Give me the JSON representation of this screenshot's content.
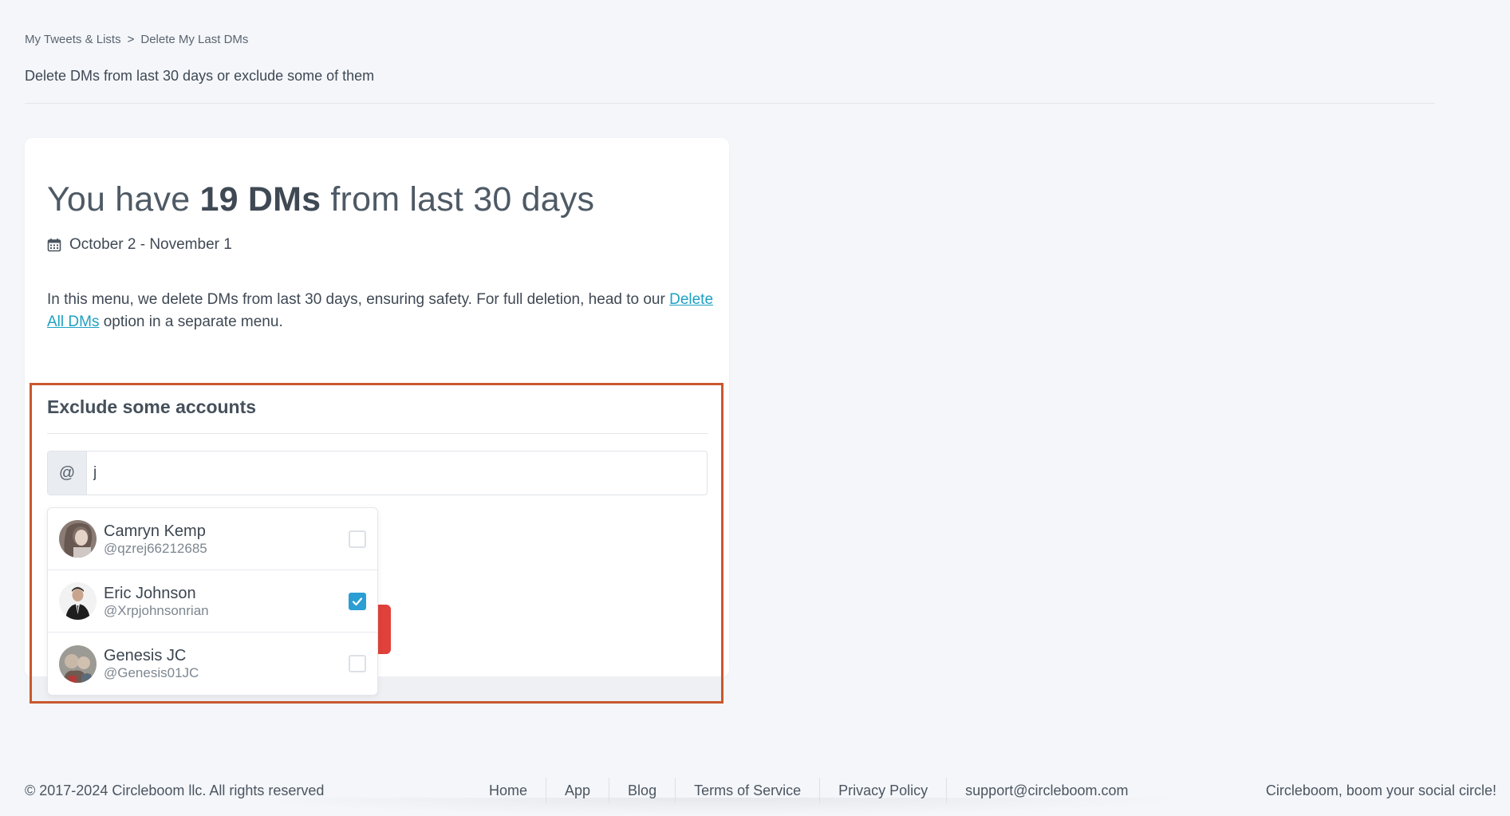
{
  "breadcrumb": {
    "items": [
      "My Tweets & Lists",
      "Delete My Last DMs"
    ],
    "separator": ">"
  },
  "subtitle": "Delete DMs from last 30 days or exclude some of them",
  "card": {
    "headline_prefix": "You have ",
    "headline_bold": "19 DMs",
    "headline_suffix": " from last 30 days",
    "date_icon": "calendar-icon",
    "date_range": "October 2 - November 1",
    "description_text": "In this menu, we delete DMs from last 30 days, ensuring safety. For full deletion, head to our ",
    "description_link": "Delete All DMs",
    "description_suffix": " option in a separate menu."
  },
  "exclude": {
    "title": "Exclude some accounts",
    "at_symbol": "@",
    "search_value": "j",
    "results": [
      {
        "name": "Camryn Kemp",
        "handle": "@qzrej66212685",
        "checked": false
      },
      {
        "name": "Eric Johnson",
        "handle": "@Xrpjohnsonrian",
        "checked": true
      },
      {
        "name": "Genesis JC",
        "handle": "@Genesis01JC",
        "checked": false
      }
    ]
  },
  "footer": {
    "copyright": "© 2017-2024 Circleboom llc. All rights reserved",
    "links": [
      "Home",
      "App",
      "Blog",
      "Terms of Service",
      "Privacy Policy",
      "support@circleboom.com"
    ],
    "tagline": "Circleboom, boom your social circle!"
  },
  "colors": {
    "accent_link": "#1da1c2",
    "highlight_border": "#c9582e",
    "checkbox_checked": "#2b9ed3",
    "danger_button": "#e0413a"
  }
}
